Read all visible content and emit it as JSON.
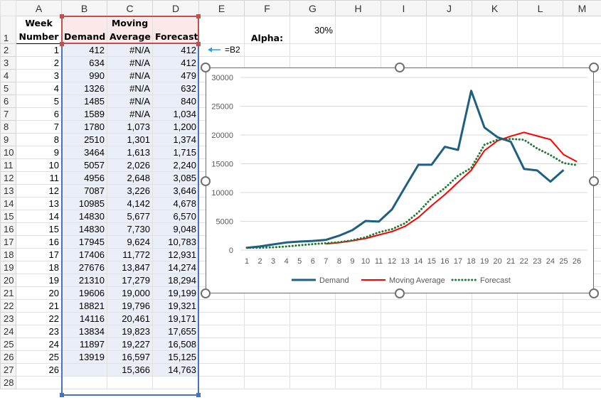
{
  "sheet": {
    "columns": [
      "A",
      "B",
      "C",
      "D",
      "E",
      "F",
      "G",
      "H",
      "I",
      "J",
      "K",
      "L",
      "M"
    ],
    "row_numbers": [
      1,
      2,
      3,
      4,
      5,
      6,
      7,
      8,
      9,
      10,
      11,
      12,
      13,
      14,
      15,
      16,
      17,
      18,
      19,
      20,
      21,
      22,
      23,
      24,
      25,
      26,
      27,
      28
    ],
    "headers": {
      "week": "Week\nNumber",
      "demand": "Demand",
      "moving_average": "Moving\nAverage",
      "forecast": "Forecast"
    },
    "alpha_label": "Alpha:",
    "alpha_value": "30%",
    "annotation": {
      "arrow_icon": "left-arrow-icon",
      "text": "=B2"
    },
    "rows": [
      [
        "1",
        "412",
        "#N/A",
        "412"
      ],
      [
        "2",
        "634",
        "#N/A",
        "412"
      ],
      [
        "3",
        "990",
        "#N/A",
        "479"
      ],
      [
        "4",
        "1326",
        "#N/A",
        "632"
      ],
      [
        "5",
        "1485",
        "#N/A",
        "840"
      ],
      [
        "6",
        "1589",
        "#N/A",
        "1,034"
      ],
      [
        "7",
        "1780",
        "1,073",
        "1,200"
      ],
      [
        "8",
        "2510",
        "1,301",
        "1,374"
      ],
      [
        "9",
        "3464",
        "1,613",
        "1,715"
      ],
      [
        "10",
        "5057",
        "2,026",
        "2,240"
      ],
      [
        "11",
        "4956",
        "2,648",
        "3,085"
      ],
      [
        "12",
        "7087",
        "3,226",
        "3,646"
      ],
      [
        "13",
        "10985",
        "4,142",
        "4,678"
      ],
      [
        "14",
        "14830",
        "5,677",
        "6,570"
      ],
      [
        "15",
        "14830",
        "7,730",
        "9,048"
      ],
      [
        "16",
        "17945",
        "9,624",
        "10,783"
      ],
      [
        "17",
        "17406",
        "11,772",
        "12,931"
      ],
      [
        "18",
        "27676",
        "13,847",
        "14,274"
      ],
      [
        "19",
        "21310",
        "17,279",
        "18,294"
      ],
      [
        "20",
        "19606",
        "19,000",
        "19,199"
      ],
      [
        "21",
        "18821",
        "19,796",
        "19,321"
      ],
      [
        "22",
        "14116",
        "20,461",
        "19,171"
      ],
      [
        "23",
        "13834",
        "19,823",
        "17,655"
      ],
      [
        "24",
        "11897",
        "19,227",
        "16,508"
      ],
      [
        "25",
        "13919",
        "16,597",
        "15,125"
      ],
      [
        "26",
        "",
        "15,366",
        "14,763"
      ]
    ],
    "colors": {
      "selection_red": "#c0504d",
      "selection_blue": "#4472c4",
      "arrow": "#2e9cf0"
    }
  },
  "chart_data": {
    "type": "line",
    "categories": [
      "1",
      "2",
      "3",
      "4",
      "5",
      "6",
      "7",
      "8",
      "9",
      "10",
      "11",
      "12",
      "13",
      "14",
      "15",
      "16",
      "17",
      "18",
      "19",
      "20",
      "21",
      "22",
      "23",
      "24",
      "25",
      "26"
    ],
    "ylim": [
      0,
      30000
    ],
    "yticks": [
      "0",
      "5000",
      "10000",
      "15000",
      "20000",
      "25000",
      "30000"
    ],
    "grid": true,
    "legend_position": "bottom",
    "series": [
      {
        "name": "Demand",
        "color": "#1f5f80",
        "style": "solid",
        "values": [
          412,
          634,
          990,
          1326,
          1485,
          1589,
          1780,
          2510,
          3464,
          5057,
          4956,
          7087,
          10985,
          14830,
          14830,
          17945,
          17406,
          27676,
          21310,
          19606,
          18821,
          14116,
          13834,
          11897,
          13919,
          null
        ]
      },
      {
        "name": "Moving Average",
        "color": "#ff0000",
        "style": "solid",
        "values": [
          null,
          null,
          null,
          null,
          null,
          null,
          1073,
          1301,
          1613,
          2026,
          2648,
          3226,
          4142,
          5677,
          7730,
          9624,
          11772,
          13847,
          17279,
          19000,
          19796,
          20461,
          19823,
          19227,
          16597,
          15366
        ]
      },
      {
        "name": "Forecast",
        "color": "#1e7b34",
        "style": "dotted",
        "values": [
          412,
          412,
          479,
          632,
          840,
          1034,
          1200,
          1374,
          1715,
          2240,
          3085,
          3646,
          4678,
          6570,
          9048,
          10783,
          12931,
          14274,
          18294,
          19199,
          19321,
          19171,
          17655,
          16508,
          15125,
          14763
        ]
      }
    ]
  }
}
